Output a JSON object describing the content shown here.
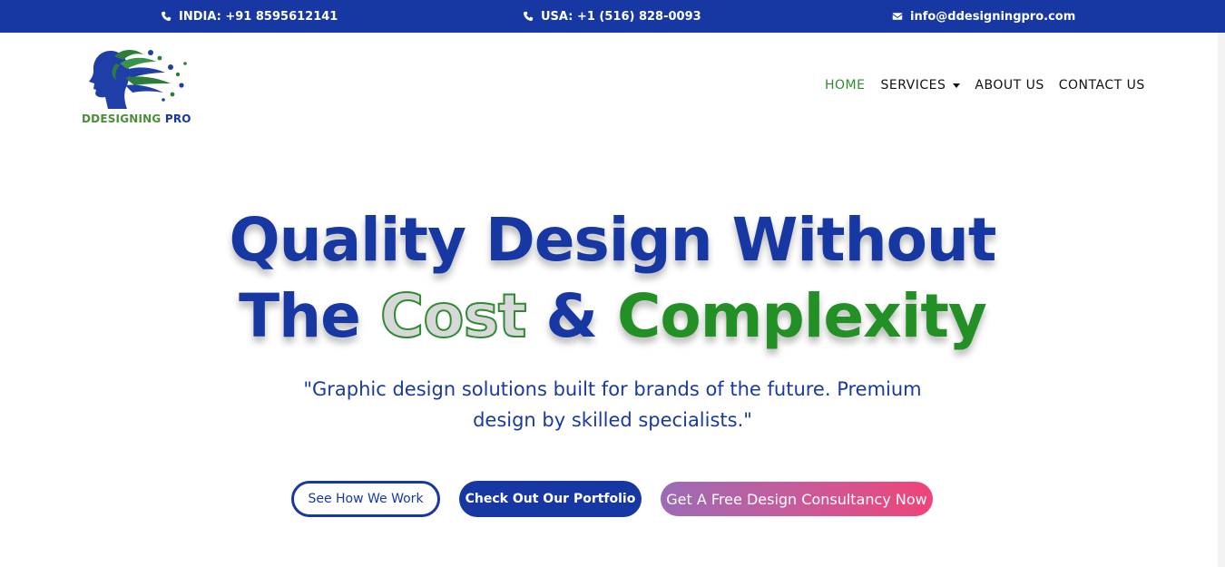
{
  "topbar": {
    "india": "INDIA: +91 8595612141",
    "usa": "USA: +1 (516) 828-0093",
    "email": "info@ddesigningpro.com"
  },
  "logo": {
    "part1": "DDESIGNING",
    "part2": "PRO"
  },
  "nav": {
    "home": "HOME",
    "services": "SERVICES",
    "about": "ABOUT US",
    "contact": "CONTACT US"
  },
  "hero": {
    "line1": "Quality Design Without",
    "line2_a": "The ",
    "line2_outline": "Cost",
    "line2_b": " & ",
    "line2_green": "Complexity",
    "subtitle": "\"Graphic design solutions built for brands of the future. Premium design by skilled specialists.\""
  },
  "buttons": {
    "how": "See How We Work",
    "portfolio": "Check Out Our Portfolio",
    "consult": "Get A Free Design Consultancy Now"
  },
  "colors": {
    "brand_blue": "#1737a3",
    "brand_green": "#2e8b32",
    "gradient_start": "#9b6bb5",
    "gradient_end": "#ef4479"
  },
  "icons": {
    "phone": "phone-icon",
    "email": "envelope-icon",
    "dropdown": "caret-down-icon"
  }
}
